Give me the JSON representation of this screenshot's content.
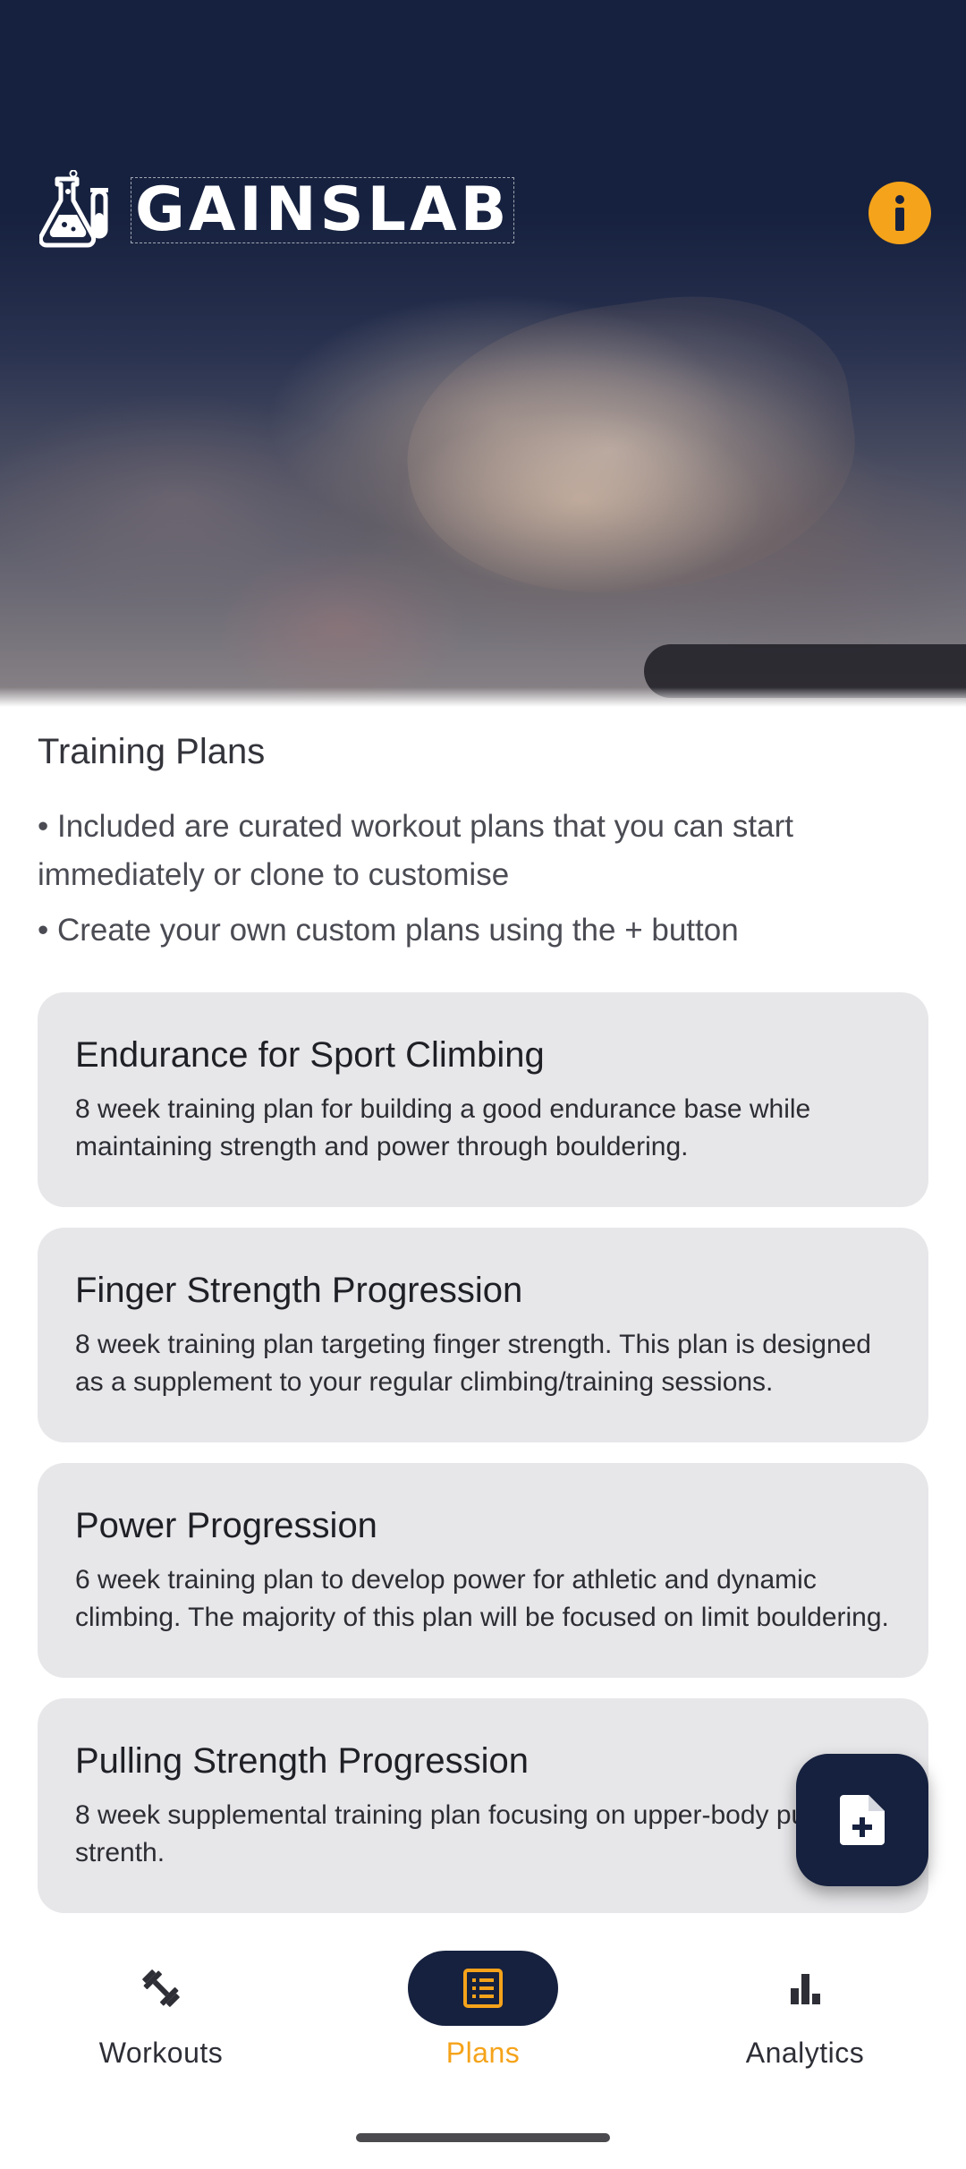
{
  "app": {
    "logo_text": "GAINSLAB"
  },
  "intro": {
    "title": "Training Plans",
    "bullets": [
      "• Included are curated workout plans that you can start immediately or clone to customise",
      "• Create your own custom plans using the + button"
    ]
  },
  "plans": [
    {
      "title": "Endurance for Sport Climbing",
      "description": "8 week training plan for building a good endurance base while maintaining strength and power through bouldering."
    },
    {
      "title": "Finger Strength Progression",
      "description": "8 week training plan targeting finger strength. This plan is designed as a supplement to your regular climbing/training sessions."
    },
    {
      "title": "Power Progression",
      "description": "6 week training plan to develop power for athletic and dynamic climbing. The majority of this plan will be focused on limit bouldering."
    },
    {
      "title": "Pulling Strength Progression",
      "description": "8 week supplemental training plan focusing on upper-body pulling strenth."
    }
  ],
  "nav": {
    "items": [
      {
        "label": "Workouts",
        "icon": "dumbbell-icon",
        "active": false
      },
      {
        "label": "Plans",
        "icon": "list-icon",
        "active": true
      },
      {
        "label": "Analytics",
        "icon": "bar-chart-icon",
        "active": false
      }
    ]
  },
  "colors": {
    "primary_navy": "#16213f",
    "accent_orange": "#f5a31a",
    "card_bg": "#e7e7ea"
  }
}
